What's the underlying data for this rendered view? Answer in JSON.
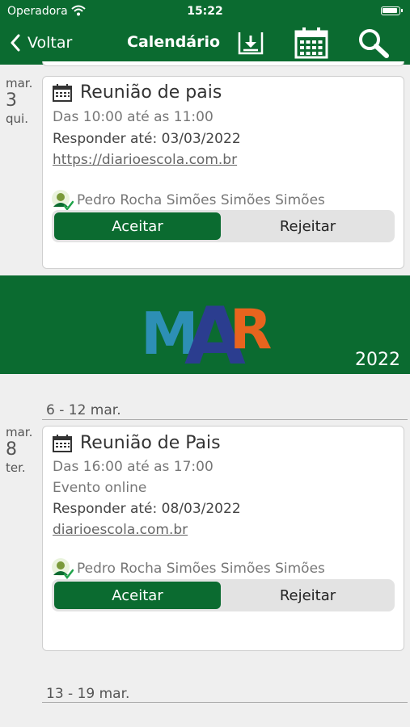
{
  "status_bar": {
    "carrier": "Operadora",
    "time": "15:22"
  },
  "nav": {
    "back_label": "Voltar",
    "title": "Calendário"
  },
  "colors": {
    "brand_green": "#0b6b30",
    "mar_blue": "#2d8fb5",
    "mar_darkblue": "#2b3d8f",
    "mar_orange": "#e8641e"
  },
  "events": [
    {
      "day": {
        "month": "mar.",
        "number": "3",
        "weekday": "qui."
      },
      "title": "Reunião de pais",
      "time": "Das 10:00 até as 11:00",
      "respond_by": "Responder até: 03/03/2022",
      "link": "https://diarioescola.com.br",
      "person": "Pedro Rocha Simões Simões Simões",
      "accept_label": "Aceitar",
      "reject_label": "Rejeitar"
    },
    {
      "day": {
        "month": "mar.",
        "number": "8",
        "weekday": "ter."
      },
      "title": "Reunião de Pais",
      "time": "Das 16:00 até as 17:00",
      "extra": "Evento online",
      "respond_by": "Responder até: 08/03/2022",
      "link": "diarioescola.com.br",
      "person": "Pedro Rocha Simões Simões Simões",
      "accept_label": "Aceitar",
      "reject_label": "Rejeitar"
    }
  ],
  "month_banner": {
    "letters": [
      "M",
      "A",
      "R"
    ],
    "year": "2022"
  },
  "weeks": [
    "6 - 12 mar.",
    "13 - 19 mar."
  ]
}
